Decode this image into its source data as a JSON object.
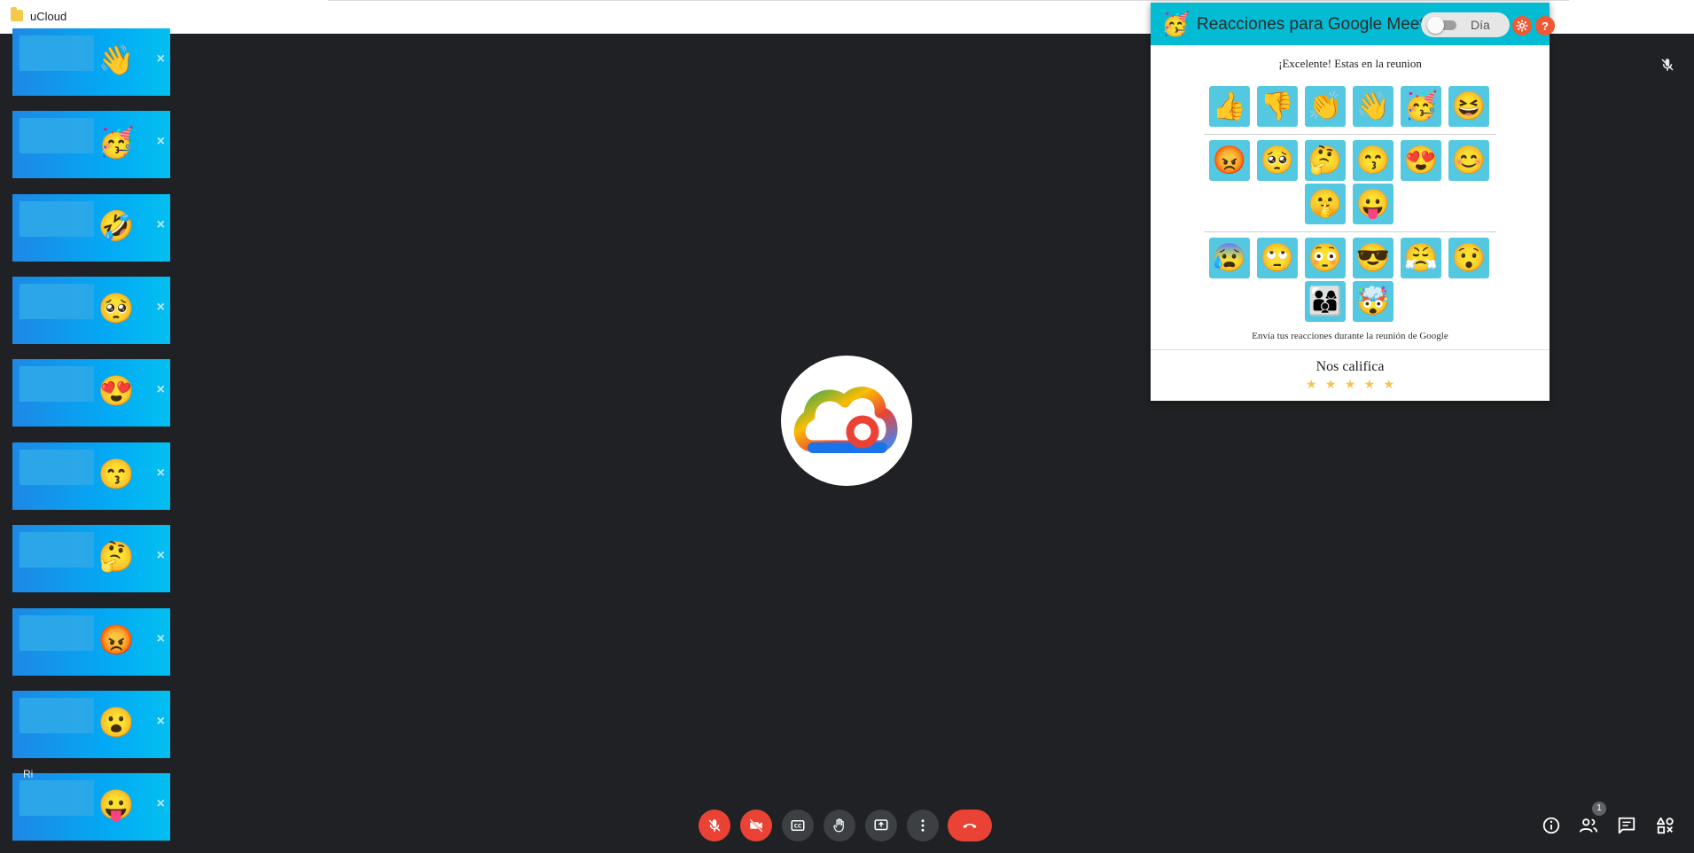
{
  "window": {
    "title": "uCloud"
  },
  "strip": {
    "tiles": [
      {
        "emoji": "👋",
        "close": "×"
      },
      {
        "emoji": "🥳",
        "close": "×"
      },
      {
        "emoji": "🤣",
        "close": "×"
      },
      {
        "emoji": "🥺",
        "close": "×"
      },
      {
        "emoji": "😍",
        "close": "×"
      },
      {
        "emoji": "😙",
        "close": "×"
      },
      {
        "emoji": "🤔",
        "close": "×"
      },
      {
        "emoji": "😡",
        "close": "×"
      },
      {
        "emoji": "😮",
        "close": "×"
      },
      {
        "emoji": "😛",
        "close": "×"
      }
    ],
    "partial_label": "Ri"
  },
  "controls": {
    "participants_count": "1"
  },
  "popup": {
    "title": "Reacciones para Google Meet",
    "logo": "🥳",
    "toggle_label": "Día",
    "status": "¡Excelente! Estas en la reunion",
    "row1": [
      "👍",
      "👎",
      "👏",
      "👋",
      "🥳",
      "😆"
    ],
    "row2": [
      "😡",
      "🥺",
      "🤔",
      "😙",
      "😍",
      "😊",
      "🤫",
      "😛"
    ],
    "row3": [
      "😰",
      "🙄",
      "😳",
      "😎",
      "😤",
      "😯",
      "👨‍👩‍👦",
      "🤯"
    ],
    "description": "Envía tus reacciones durante la reunión de Google",
    "rate_title": "Nos califica",
    "stars": [
      "★",
      "★",
      "★",
      "★",
      "★"
    ]
  },
  "colors": {
    "background": "#202124",
    "popup_header": "#03bcd4",
    "emoji_button": "#54c8e0",
    "control_red": "#ea4335",
    "star": "#f5c451"
  }
}
